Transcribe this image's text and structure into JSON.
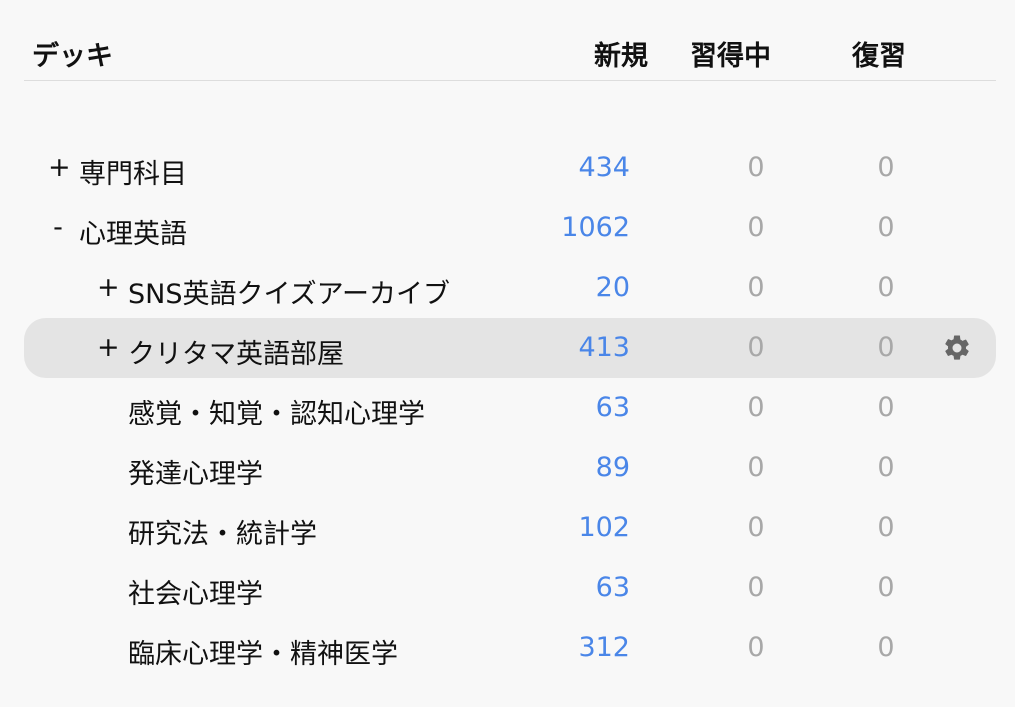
{
  "header": {
    "deck": "デッキ",
    "new": "新規",
    "learning": "習得中",
    "review": "復習"
  },
  "rows": [
    {
      "expander": "+",
      "name": "専門科目",
      "new": "434",
      "learning": "0",
      "review": "0"
    },
    {
      "expander": "-",
      "name": "心理英語",
      "new": "1062",
      "learning": "0",
      "review": "0"
    },
    {
      "expander": "+",
      "name": "SNS英語クイズアーカイブ",
      "new": "20",
      "learning": "0",
      "review": "0"
    },
    {
      "expander": "+",
      "name": "クリタマ英語部屋",
      "new": "413",
      "learning": "0",
      "review": "0"
    },
    {
      "name": "感覚・知覚・認知心理学",
      "new": "63",
      "learning": "0",
      "review": "0"
    },
    {
      "name": "発達心理学",
      "new": "89",
      "learning": "0",
      "review": "0"
    },
    {
      "name": "研究法・統計学",
      "new": "102",
      "learning": "0",
      "review": "0"
    },
    {
      "name": "社会心理学",
      "new": "63",
      "learning": "0",
      "review": "0"
    },
    {
      "name": "臨床心理学・精神医学",
      "new": "312",
      "learning": "0",
      "review": "0"
    }
  ],
  "selected_row": "クリタマ英語部屋",
  "icons": {
    "options": "gear-icon"
  },
  "colors": {
    "new_count": "#4a86e8",
    "zero_count": "#a8a8a8",
    "selection": "#e4e4e4"
  }
}
